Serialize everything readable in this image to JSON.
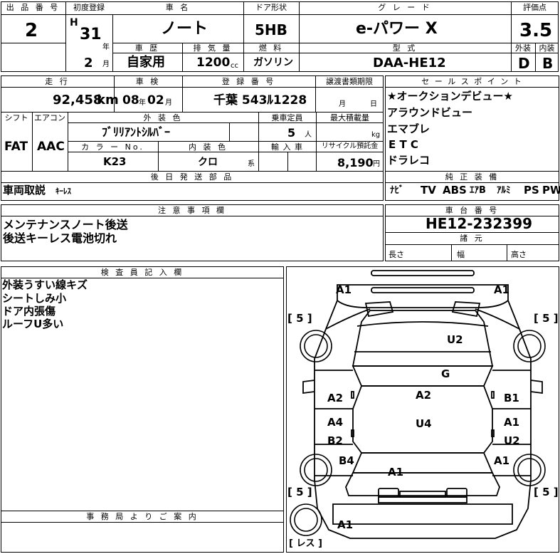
{
  "header": {
    "lot_no_label": "出 品 番 号",
    "lot_no": "2",
    "first_reg_label": "初度登録",
    "era": "H",
    "year": "31",
    "year_unit": "年",
    "month": "2",
    "month_unit": "月",
    "car_name_label": "車 名",
    "car_name": "ノート",
    "door_label": "ドア形状",
    "door": "5HB",
    "grade_label": "グ レ ー ド",
    "grade": "e-パワー X",
    "score_label": "評価点",
    "score": "3.5",
    "history_label": "車 歴",
    "history": "自家用",
    "displacement_label": "排 気 量",
    "displacement": "1200",
    "displacement_unit": "cc",
    "fuel_label": "燃 料",
    "fuel": "ガソリン",
    "model_label": "型 式",
    "model": "DAA-HE12",
    "exterior_label": "外装",
    "exterior": "D",
    "interior_label": "内装",
    "interior": "B"
  },
  "row2": {
    "mileage_label": "走 行",
    "mileage": "92,458",
    "mileage_unit": "km",
    "inspection_label": "車 検",
    "insp_year": "08",
    "insp_year_unit": "年",
    "insp_month": "02",
    "insp_month_unit": "月",
    "reg_no_label": "登 録 番 号",
    "reg_no": "千葉 543ﾙ1228",
    "transfer_label": "譲渡書類期限",
    "transfer_month": "月",
    "transfer_day": "日",
    "shift_label": "シフト",
    "shift": "FAT",
    "ac_label": "エアコン",
    "ac": "AAC",
    "color_label": "外 装 色",
    "color": "ﾌﾞﾘﾘｱﾝﾄｼﾙﾊﾞｰ",
    "capacity_label": "乗車定員",
    "capacity": "5",
    "capacity_unit": "人",
    "load_label": "最大積載量",
    "load_unit": "kg",
    "color_no_label": "カ ラ ー No.",
    "color_no": "K23",
    "int_color_label": "内 装 色",
    "int_color": "クロ",
    "int_color_unit": "系",
    "import_label": "輸 入 車",
    "recycle_label": "リサイクル預託金",
    "recycle": "8,190",
    "recycle_unit": "円",
    "later_parts_label": "後 日 発 送 部 品",
    "later_parts_a": "車両取説",
    "later_parts_b": "ｷｰﾚｽ"
  },
  "sales": {
    "label": "セ ー ル ス ポ イ ン ト",
    "points": [
      "★オークションデビュー★",
      "アラウンドビュー",
      "エマブレ",
      "E T C",
      "ドラレコ"
    ]
  },
  "equipment": {
    "label": "純 正 装 備",
    "items": [
      "ﾅﾋﾞ",
      "TV",
      "ABS",
      "ｴｱB",
      "ｱﾙﾐ",
      "PS",
      "PW"
    ]
  },
  "notes": {
    "label": "注 意 事 項 欄",
    "lines": [
      "メンテナンスノート後送",
      "後送キーレス電池切れ"
    ]
  },
  "chassis": {
    "label": "車 台 番 号",
    "number": "HE12-232399",
    "dims_label": "諸 元",
    "length": "長さ",
    "width": "幅",
    "height": "高さ"
  },
  "inspector": {
    "label": "検 査 員 記 入 欄",
    "lines": [
      "外装うすい線キズ",
      "シートしみ小",
      "ドア内張傷",
      "ルーフU多い"
    ]
  },
  "office": {
    "label": "事 務 局 よ り ご 案 内"
  },
  "diagram": {
    "tire_fl": "[ 5 ]",
    "tire_fr": "[ 5 ]",
    "tire_rl": "[ 5 ]",
    "tire_rr": "[ 5 ]",
    "spare": "[ レス ]",
    "marks": {
      "front_left": "A1",
      "front_right": "A1",
      "hood": "U2",
      "windshield": "G",
      "roof": "A2",
      "roof_lower": "U4",
      "front_door_l": "A2",
      "rear_door_l_a": "A4",
      "rear_door_l_b": "B2",
      "front_door_r": "B1",
      "rear_door_r_a": "A1",
      "rear_door_r_b": "U2",
      "quarter_l": "B4",
      "quarter_r": "A1",
      "trunk": "A1",
      "rear_bumper": "A1"
    }
  }
}
